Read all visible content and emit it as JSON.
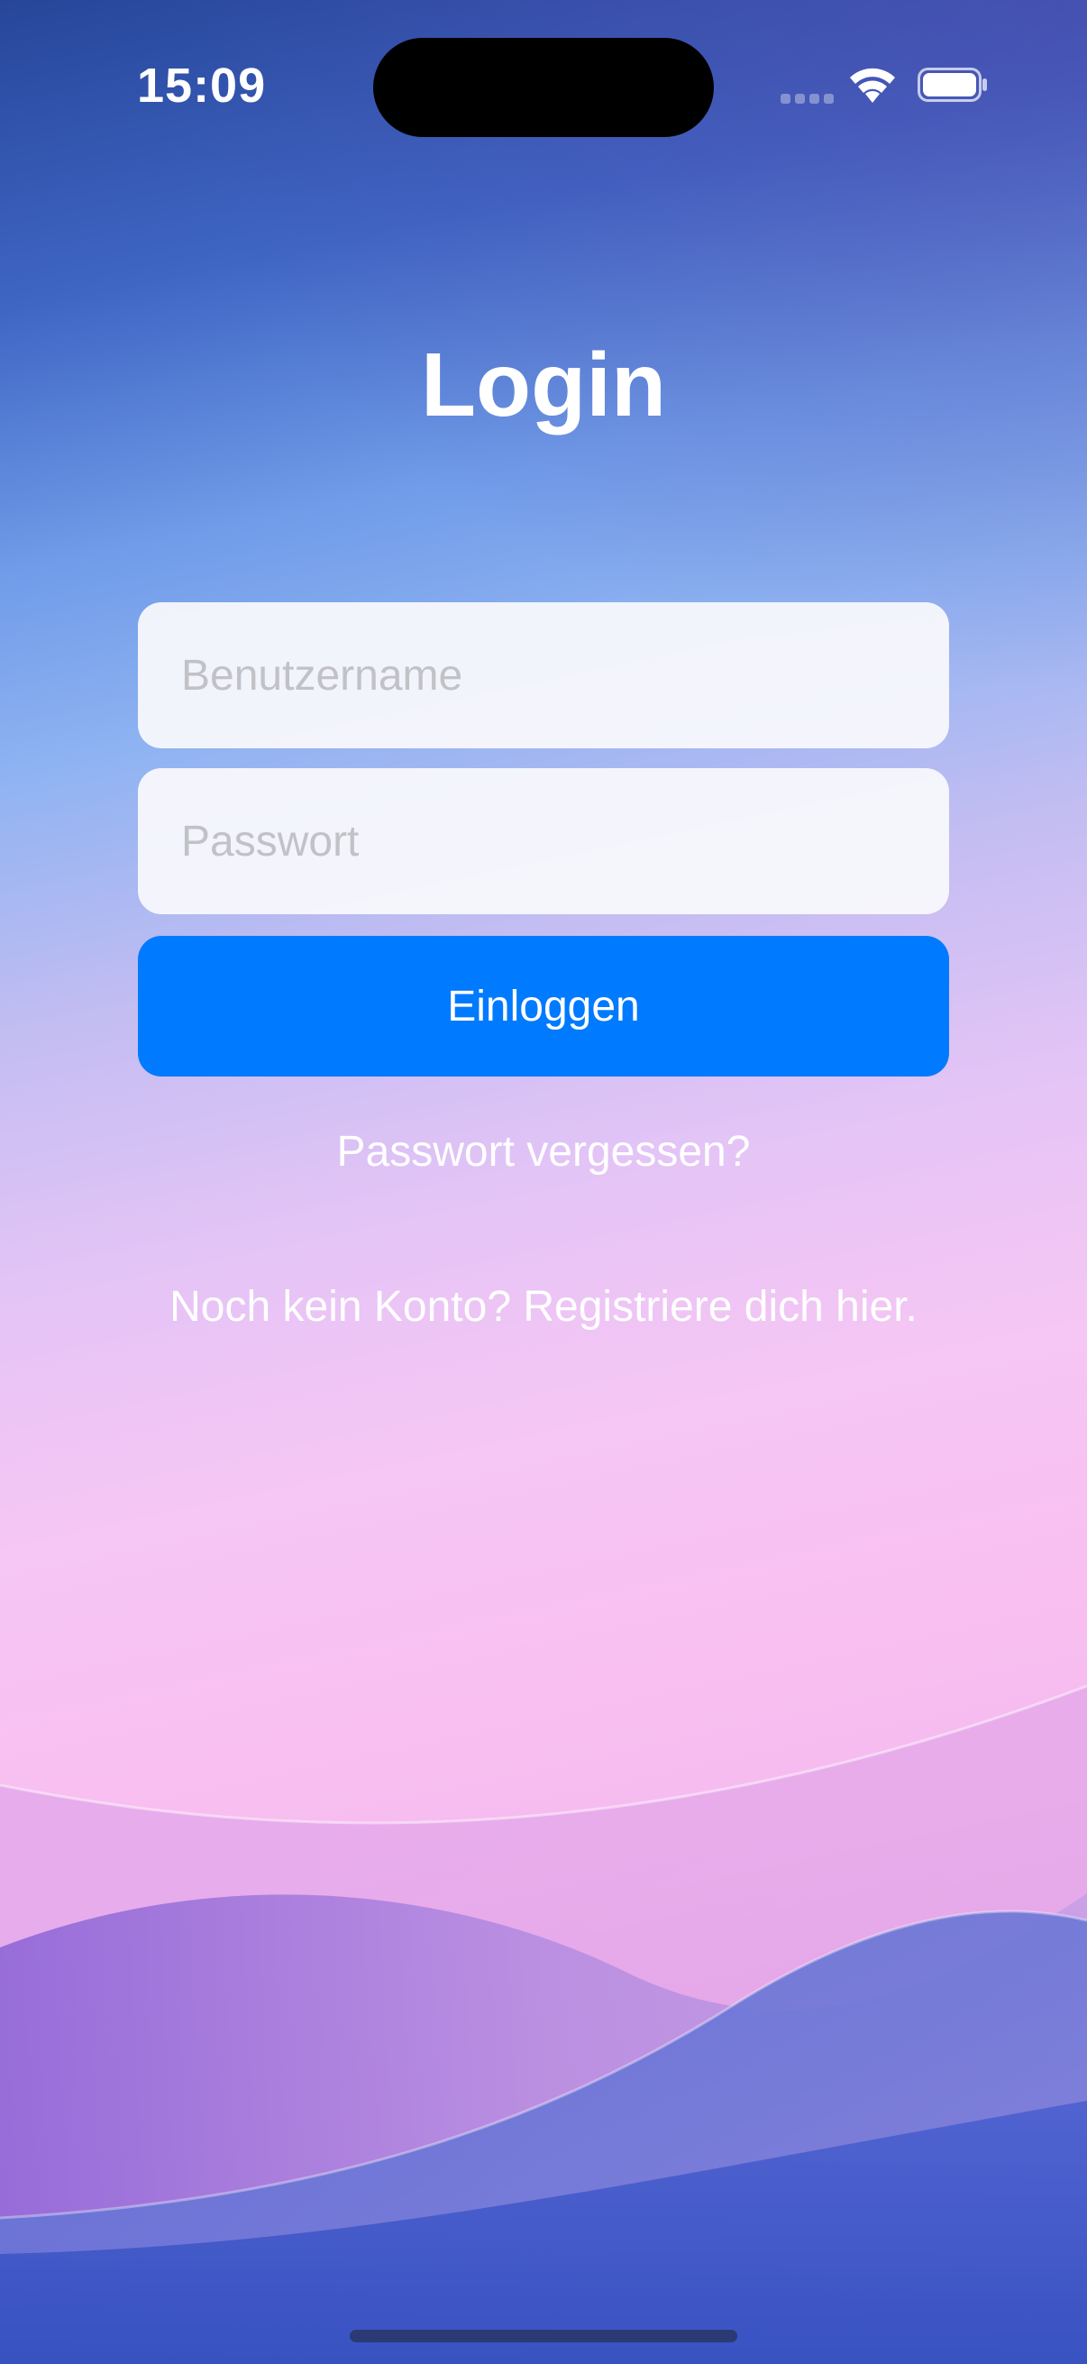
{
  "status_bar": {
    "time": "15:09",
    "icons": [
      "cellular-signal-icon",
      "wifi-icon",
      "battery-icon"
    ]
  },
  "login": {
    "title": "Login",
    "username_placeholder": "Benutzername",
    "username_value": "",
    "password_placeholder": "Passwort",
    "password_value": "",
    "login_button_label": "Einloggen",
    "forgot_password_link": "Passwort vergessen?",
    "register_link": "Noch kein Konto? Registriere dich hier."
  },
  "colors": {
    "accent": "#007aff",
    "text": "#ffffff",
    "placeholder": "#c2c2c6",
    "field_bg": "#f8f8fc"
  }
}
